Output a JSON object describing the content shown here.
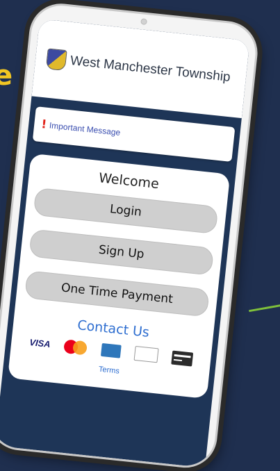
{
  "header": {
    "logo_icon": "township-crest-icon",
    "title": "West Manchester Township"
  },
  "notice": {
    "icon": "exclamation-icon",
    "mark": "!",
    "label": "Important Message"
  },
  "card": {
    "welcome": "Welcome",
    "login_label": "Login",
    "signup_label": "Sign Up",
    "payment_label": "One Time Payment",
    "contact_label": "Contact Us",
    "payment_methods": {
      "visa": "VISA",
      "mastercard_icon": "mastercard-icon",
      "amex_icon": "amex-icon",
      "discover_icon": "discover-icon",
      "generic_card_icon": "card-icon"
    },
    "terms_label": "Terms"
  },
  "colors": {
    "background": "#1f2f4f",
    "accent_green": "#7fc03b",
    "accent_yellow": "#f2c623",
    "header_bar": "#1e3557",
    "link_blue": "#2e6ed0",
    "alert_red": "#e1241b"
  }
}
